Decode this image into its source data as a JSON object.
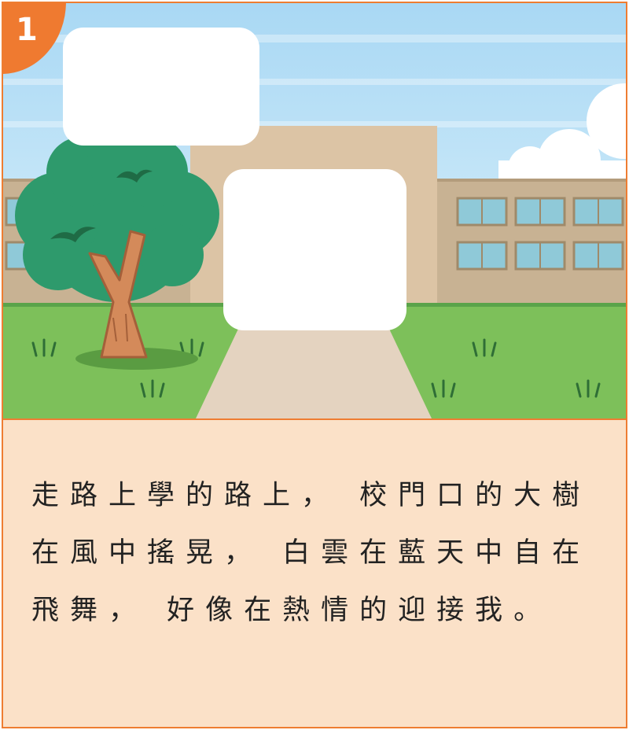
{
  "page": {
    "number": "1"
  },
  "story": {
    "text": "走路上學的路上， 校門口的大樹在風中搖晃， 白雲在藍天中自在飛舞， 好像在熱情的迎接我。"
  },
  "colors": {
    "border": "#ee7d32",
    "badge": "#ef7a30",
    "panel": "#fbe1c8",
    "sky": "#bfe3f6",
    "grass": "#7dc05a",
    "building": "#c8b293",
    "tree": "#2e9a6c"
  },
  "illustration": {
    "elements": [
      "sky",
      "clouds",
      "school-building",
      "windows",
      "grass",
      "path",
      "tree",
      "birds",
      "speech-bubble",
      "speech-bubble"
    ]
  }
}
